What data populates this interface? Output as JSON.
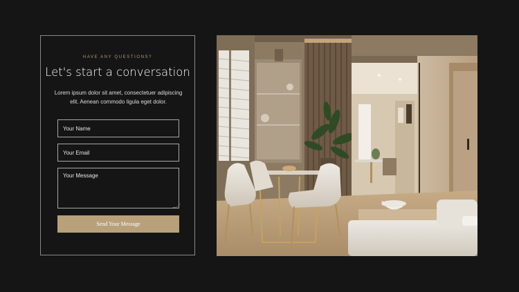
{
  "contact": {
    "eyebrow": "HAVE ANY QUESTIONS?",
    "heading": "Let's start a conversation",
    "intro": "Lorem ipsum dolor sit amet, consectetuer adipiscing elit. Aenean commodo ligula eget dolor.",
    "name_placeholder": "Your Name",
    "email_placeholder": "Your Email",
    "message_placeholder": "Your Message",
    "submit_label": "Send Your Message"
  },
  "colors": {
    "background": "#151516",
    "accent": "#b8a07b",
    "eyebrow": "#b59b74",
    "border": "#8a8a8a"
  },
  "image": {
    "subject": "interior-dining-room-photo"
  }
}
